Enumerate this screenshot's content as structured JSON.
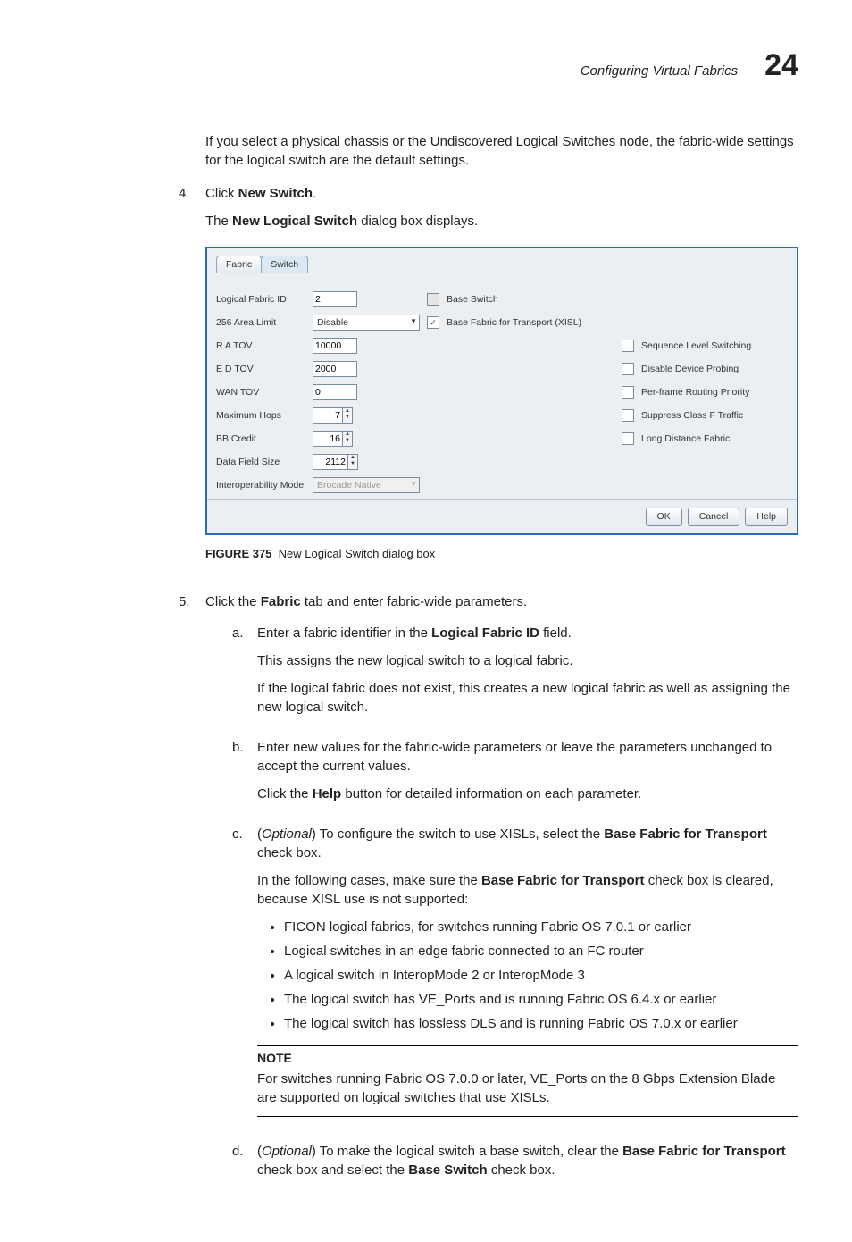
{
  "header": {
    "title": "Configuring Virtual Fabrics",
    "chapter": "24"
  },
  "intro": "If you select a physical chassis or the Undiscovered Logical Switches node, the fabric-wide settings for the logical switch are the default settings.",
  "step4": {
    "num": "4.",
    "lead": "Click ",
    "bold": "New Switch",
    "tail": ".",
    "result_a": "The ",
    "result_b": "New Logical Switch",
    "result_c": " dialog box displays."
  },
  "dialog": {
    "tab_fabric": "Fabric",
    "tab_switch": "Switch",
    "lbl_logical_fabric_id": "Logical Fabric ID",
    "lbl_256_area": "256 Area Limit",
    "lbl_ra_tov": "R A TOV",
    "lbl_ed_tov": "E D TOV",
    "lbl_wan_tov": "WAN TOV",
    "lbl_max_hops": "Maximum Hops",
    "lbl_bb_credit": "BB Credit",
    "lbl_data_field": "Data Field Size",
    "lbl_interop": "Interoperability Mode",
    "val_logical_fabric_id": "2",
    "val_256_area": "Disable",
    "val_ra_tov": "10000",
    "val_ed_tov": "2000",
    "val_wan_tov": "0",
    "val_max_hops": "7",
    "val_bb_credit": "16",
    "val_data_field": "2112",
    "val_interop": "Brocade Native",
    "chk_base_switch": "Base Switch",
    "chk_base_fabric": "Base Fabric for Transport (XISL)",
    "chk_seq_level": "Sequence Level Switching",
    "chk_disable_probing": "Disable Device Probing",
    "chk_per_frame": "Per-frame Routing Priority",
    "chk_suppress_f": "Suppress Class F Traffic",
    "chk_long_distance": "Long Distance Fabric",
    "btn_ok": "OK",
    "btn_cancel": "Cancel",
    "btn_help": "Help"
  },
  "figure": {
    "label": "FIGURE 375",
    "caption": "New Logical Switch dialog box"
  },
  "step5": {
    "num": "5.",
    "a": "Click the ",
    "b": "Fabric",
    "c": " tab and enter fabric-wide parameters."
  },
  "sub_a": {
    "letter": "a.",
    "l1a": "Enter a fabric identifier in the ",
    "l1b": "Logical Fabric ID",
    "l1c": " field.",
    "l2": "This assigns the new logical switch to a logical fabric.",
    "l3": "If the logical fabric does not exist, this creates a new logical fabric as well as assigning the new logical switch."
  },
  "sub_b": {
    "letter": "b.",
    "l1": "Enter new values for the fabric-wide parameters or leave the parameters unchanged to accept the current values.",
    "l2a": "Click the ",
    "l2b": "Help",
    "l2c": " button for detailed information on each parameter."
  },
  "sub_c": {
    "letter": "c.",
    "l1a": "(",
    "l1b": "Optional",
    "l1c": ") To configure the switch to use XISLs, select the ",
    "l1d": "Base Fabric for Transport",
    "l1e": " check box.",
    "l2a": "In the following cases, make sure the ",
    "l2b": "Base Fabric for Transport",
    "l2c": " check box is cleared, because XISL use is not supported:",
    "bullets": [
      "FICON logical fabrics, for switches running Fabric OS 7.0.1 or earlier",
      "Logical switches in an edge fabric connected to an FC router",
      "A logical switch in InteropMode 2 or InteropMode 3",
      "The logical switch has VE_Ports and is running Fabric OS 6.4.x or earlier",
      "The logical switch has lossless DLS and is running Fabric OS 7.0.x or earlier"
    ],
    "note_head": "NOTE",
    "note_body": "For switches running Fabric OS 7.0.0 or later, VE_Ports on the 8 Gbps Extension Blade are supported on logical switches that use XISLs."
  },
  "sub_d": {
    "letter": "d.",
    "a": "(",
    "b": "Optional",
    "c": ") To make the logical switch a base switch, clear the ",
    "d": "Base Fabric for Transport",
    "e": " check box and select the ",
    "f": "Base Switch",
    "g": " check box."
  }
}
